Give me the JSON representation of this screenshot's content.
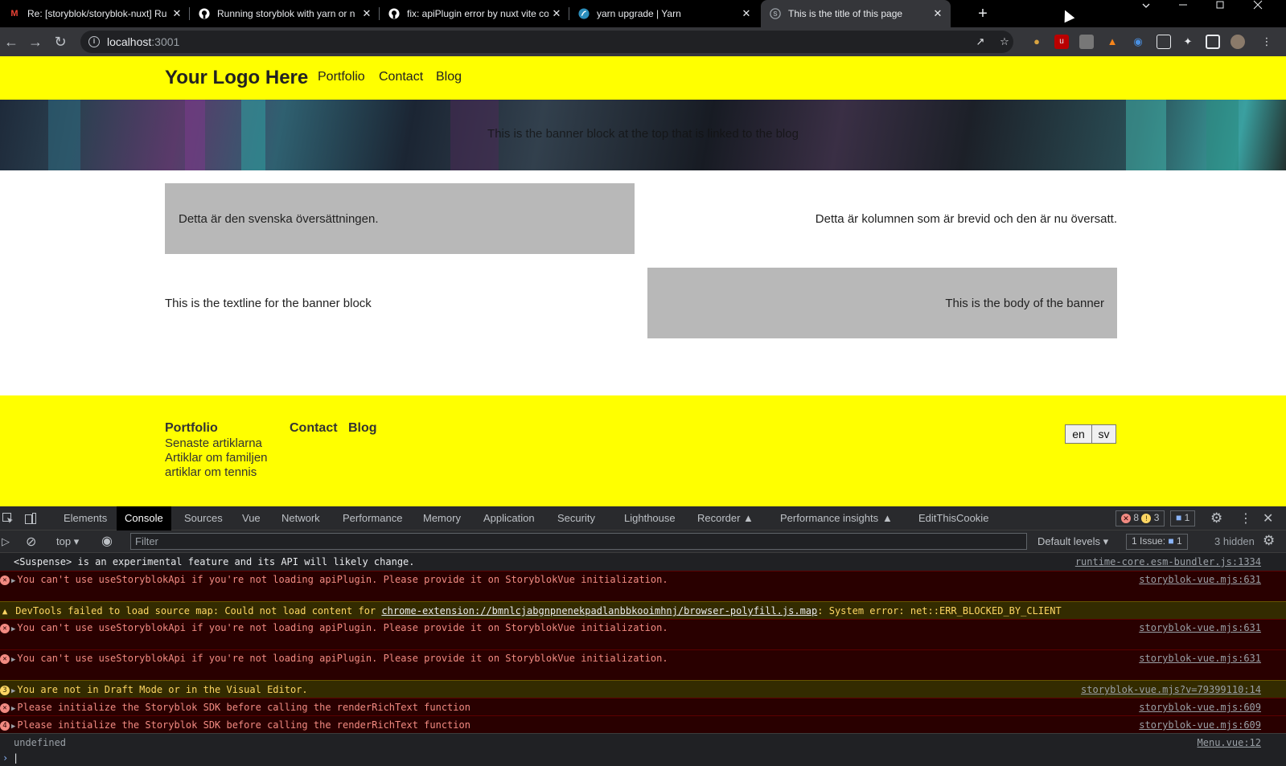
{
  "browser": {
    "tabs": [
      {
        "title": "Re: [storyblok/storyblok-nuxt] Ru",
        "icon": "gmail-icon",
        "color": "#ea4335",
        "active": false
      },
      {
        "title": "Running storyblok with yarn or n",
        "icon": "github-icon",
        "color": "#ffffff",
        "active": false
      },
      {
        "title": "fix: apiPlugin error by nuxt vite co",
        "icon": "github-icon",
        "color": "#ffffff",
        "active": false
      },
      {
        "title": "yarn upgrade | Yarn",
        "icon": "yarn-icon",
        "color": "#2c8ebb",
        "active": false
      },
      {
        "title": "This is the title of this page",
        "icon": "storyblok-icon",
        "color": "#9aa0a6",
        "active": true
      }
    ],
    "close_glyph": "✕",
    "new_tab_glyph": "+",
    "url_host": "localhost",
    "url_port": ":3001"
  },
  "site": {
    "logo": "Your Logo Here",
    "nav": [
      "Portfolio",
      "Contact",
      "Blog"
    ],
    "banner_text": "This is the banner block at the top that is linked to the blog",
    "grid": {
      "cell1": "Detta är den svenska översättningen.",
      "cell2": "Detta är kolumnen som är brevid och den är nu översatt.",
      "cell3": "This is the textline for the banner block",
      "cell4": "This is the body of the banner"
    },
    "footer": {
      "portfolio": "Portfolio",
      "portfolio_links": [
        "Senaste artiklarna",
        "Artiklar om familjen",
        "artiklar om tennis"
      ],
      "contact": "Contact",
      "blog": "Blog",
      "lang_en": "en",
      "lang_sv": "sv"
    }
  },
  "devtools": {
    "tabs": [
      "Elements",
      "Console",
      "Sources",
      "Vue",
      "Network",
      "Performance",
      "Memory",
      "Application",
      "Security",
      "Lighthouse",
      "Recorder",
      "Performance insights",
      "EditThisCookie"
    ],
    "error_count": "8",
    "warn_count": "3",
    "msg_count": "1",
    "context": "top",
    "filter_placeholder": "Filter",
    "levels": "Default levels",
    "issues_label": "1 Issue:",
    "issues_count": "1",
    "hidden": "3 hidden",
    "logs": [
      {
        "type": "info",
        "msg": "<Suspense> is an experimental feature and its API will likely change.",
        "src": "runtime-core.esm-bundler.js:1334"
      },
      {
        "type": "err",
        "msg": "You can't use useStoryblokApi if you're not loading apiPlugin. Please provide it on StoryblokVue initialization.",
        "src": "storyblok-vue.mjs:631"
      },
      {
        "type": "warn",
        "msg": "DevTools failed to load source map: Could not load content for",
        "link": "chrome-extension://bmnlcjabgnpnenekpadlanbbkooimhnj/browser-polyfill.js.map",
        "tail": ": System error: net::ERR_BLOCKED_BY_CLIENT",
        "src": ""
      },
      {
        "type": "err",
        "msg": "You can't use useStoryblokApi if you're not loading apiPlugin. Please provide it on StoryblokVue initialization.",
        "src": "storyblok-vue.mjs:631"
      },
      {
        "type": "err",
        "msg": "You can't use useStoryblokApi if you're not loading apiPlugin. Please provide it on StoryblokVue initialization.",
        "src": "storyblok-vue.mjs:631"
      },
      {
        "type": "warn",
        "count": "3",
        "msg": "You are not in Draft Mode or in the Visual Editor.",
        "src": "storyblok-vue.mjs?v=79399110:14"
      },
      {
        "type": "err",
        "msg": "Please initialize the Storyblok SDK before calling the renderRichText function",
        "src": "storyblok-vue.mjs:609"
      },
      {
        "type": "err",
        "count": "4",
        "msg": "Please initialize the Storyblok SDK before calling the renderRichText function",
        "src": "storyblok-vue.mjs:609"
      },
      {
        "type": "info",
        "msg": "undefined",
        "src": "Menu.vue:12"
      }
    ]
  }
}
